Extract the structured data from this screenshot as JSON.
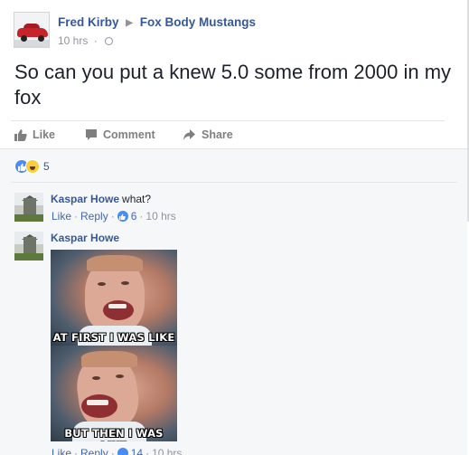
{
  "post": {
    "author": "Fred Kirby",
    "group": "Fox Body Mustangs",
    "time": "10 hrs",
    "text": "So can you put a knew 5.0 some from 2000 in my fox",
    "actions": {
      "like": "Like",
      "comment": "Comment",
      "share": "Share"
    },
    "reaction_count": "5"
  },
  "comments": [
    {
      "author": "Kaspar Howe",
      "text": "what?",
      "like": "Like",
      "reply": "Reply",
      "likes": "6",
      "time": "10 hrs"
    },
    {
      "author": "Kaspar Howe",
      "image": {
        "top_caption": "AT FIRST I WAS LIKE",
        "bottom_caption": "BUT THEN I WAS LIKE"
      },
      "like": "Like",
      "reply": "Reply",
      "likes": "14",
      "time": "10 hrs"
    }
  ],
  "colors": {
    "link": "#365899",
    "muted": "#90949c",
    "like_blue": "#4b8bf5",
    "comment_bg": "#f6f7f9"
  }
}
